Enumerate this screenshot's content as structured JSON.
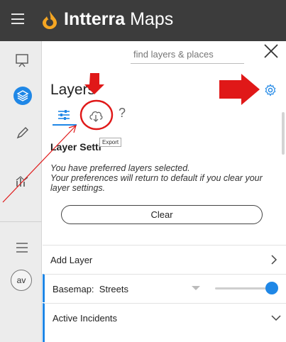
{
  "app": {
    "brand_bold": "Intterra",
    "brand_light": "Maps"
  },
  "search": {
    "placeholder": "find layers & places"
  },
  "panel": {
    "title": "Layers",
    "tabs": {
      "help_label": "?"
    },
    "tooltip": "Export",
    "section_title": "Layer Settings",
    "info_lines": [
      "You have preferred layers selected.",
      "Your preferences will return to default if you clear your layer settings."
    ],
    "clear_label": "Clear",
    "rows": {
      "add_layer": "Add Layer",
      "basemap_label": "Basemap:",
      "basemap_value": "Streets",
      "basemap_opacity": 1.0,
      "active_incidents": "Active Incidents"
    }
  },
  "rail": {
    "avatar_initials": "av"
  },
  "colors": {
    "accent": "#1f87e6",
    "topbar": "#3c3c3c",
    "annotation": "#e01818",
    "logo": "#f5a623"
  },
  "icons": [
    "menu-icon",
    "logo-icon",
    "presentation-icon",
    "layers-icon",
    "pencil-icon",
    "chart-icon",
    "list-icon",
    "close-icon",
    "gear-icon",
    "filters-icon",
    "cloud-download-icon",
    "chevron-right-icon",
    "chevron-down-icon"
  ]
}
